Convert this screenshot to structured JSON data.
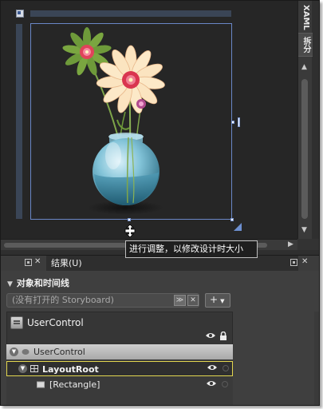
{
  "side_tabs": {
    "xaml": "XAML",
    "split": "拆分"
  },
  "tooltip": "进行调整，以修改设计时大小",
  "panel_tabs": {
    "results": "结果(U)",
    "close": "✕"
  },
  "objects_panel": {
    "header": "对象和时间线",
    "storyboard_placeholder": "(没有打开的 Storyboard)",
    "add_label": "+",
    "scope": {
      "title": "UserControl"
    },
    "tree": [
      {
        "label": "UserControl",
        "state": "normal"
      },
      {
        "label": "LayoutRoot",
        "state": "active"
      },
      {
        "label": "[Rectangle]",
        "state": "normal"
      }
    ]
  },
  "icons": {
    "visibility": "eye-icon",
    "lock": "lock-icon",
    "resize_cursor": "resize-vertical-cursor-icon"
  },
  "colors": {
    "selection_border": "#6a87c6",
    "active_row_border": "#e2d64f",
    "vase": "#6fb3cc",
    "petal": "#fbe4c0",
    "flower_center": "#e0435a",
    "leaf": "#6e9a3a"
  }
}
